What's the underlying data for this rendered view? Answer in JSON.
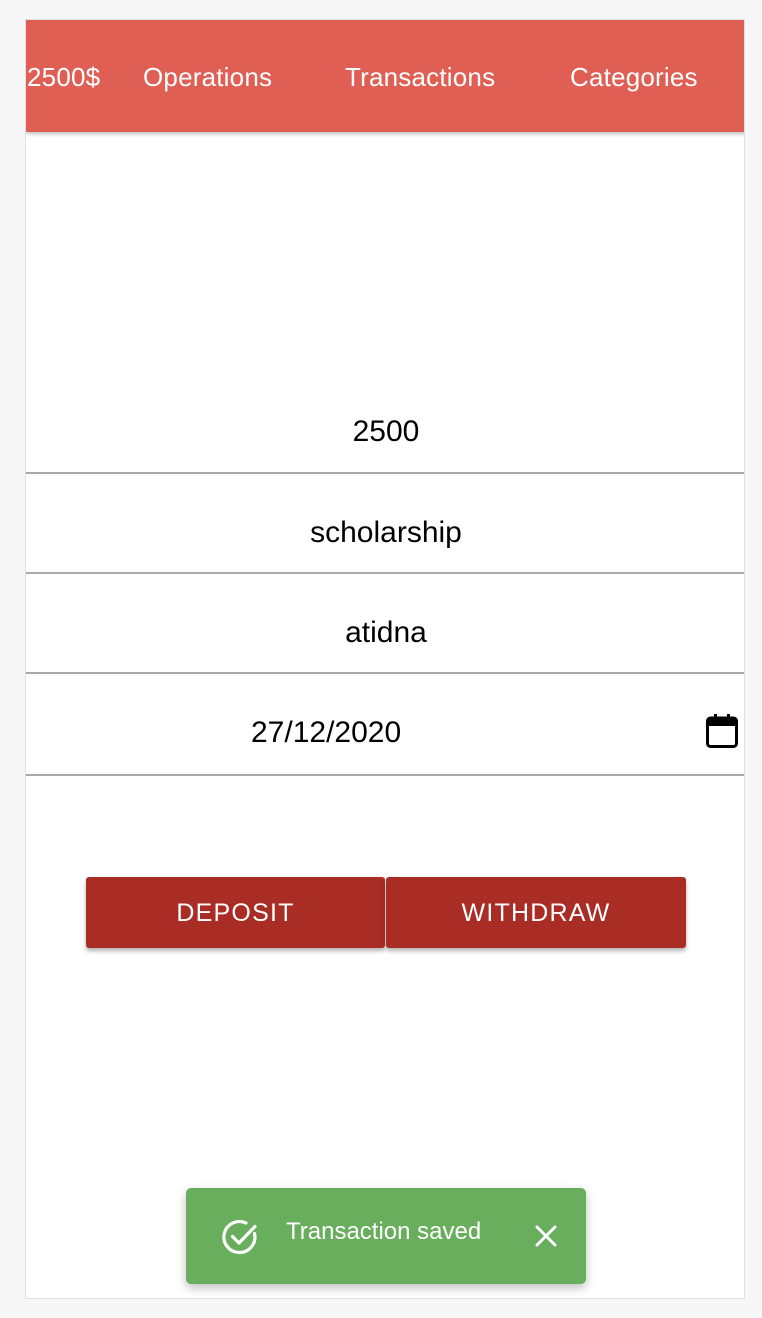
{
  "navbar": {
    "balance": "2500$",
    "operations": "Operations",
    "transactions": "Transactions",
    "categories": "Categories",
    "background_color": "#e05f55"
  },
  "form": {
    "amount": "2500",
    "category": "scholarship",
    "vendor": "atidna",
    "date": "27/12/2020",
    "date_icon": "calendar-icon"
  },
  "actions": {
    "deposit_label": "DEPOSIT",
    "withdraw_label": "WITHDRAW",
    "button_color": "#a92c25"
  },
  "snackbar": {
    "message": "Transaction saved",
    "status_icon": "check-circle-icon",
    "close_icon": "close-icon",
    "color": "#69ae5c"
  }
}
